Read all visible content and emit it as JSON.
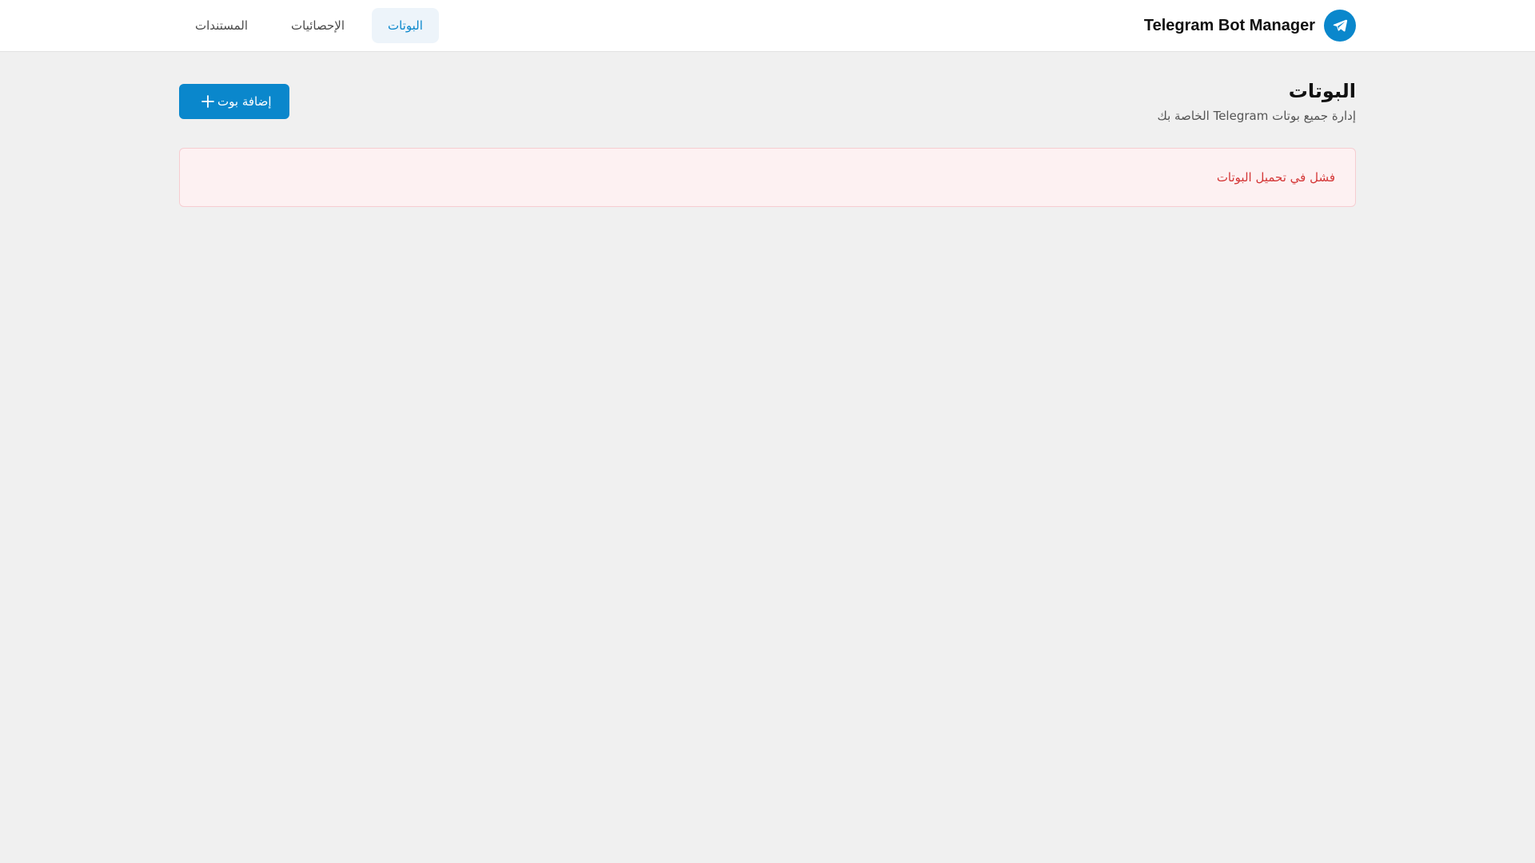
{
  "header": {
    "brand_title": "Telegram Bot Manager",
    "logo_icon": "telegram-plane-icon",
    "nav": [
      {
        "label": "البوتات",
        "active": true
      },
      {
        "label": "الإحصائيات",
        "active": false
      },
      {
        "label": "المستندات",
        "active": false
      }
    ]
  },
  "page": {
    "title": "البوتات",
    "subtitle": "إدارة جميع بوتات Telegram الخاصة بك",
    "add_button_label": "إضافة بوت",
    "add_button_icon": "plus-icon"
  },
  "alert": {
    "message": "فشل في تحميل البوتات"
  },
  "colors": {
    "accent": "#0a87cc",
    "error_text": "#d43636",
    "error_bg": "#fdf1f2",
    "background": "#f0f0f0"
  }
}
